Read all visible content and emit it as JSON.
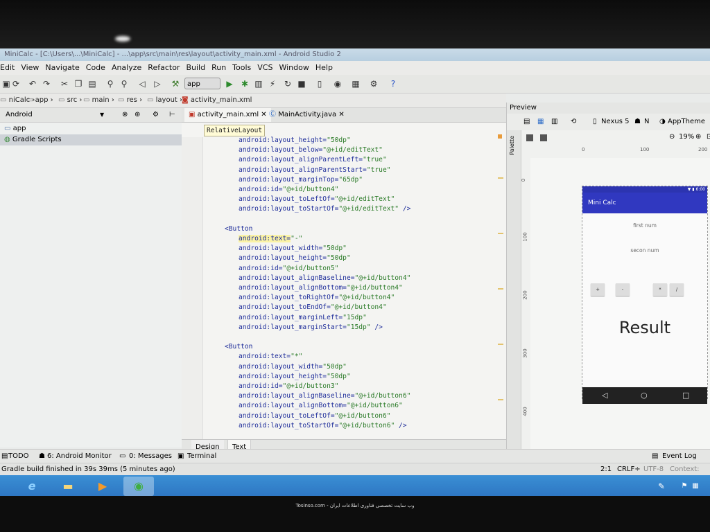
{
  "window": {
    "title": "MiniCalc - [C:\\Users\\...\\MiniCalc] - ...\\app\\src\\main\\res\\layout\\activity_main.xml - Android Studio 2"
  },
  "menu": [
    "Edit",
    "View",
    "Navigate",
    "Code",
    "Analyze",
    "Refactor",
    "Build",
    "Run",
    "Tools",
    "VCS",
    "Window",
    "Help"
  ],
  "toolbar": {
    "run_config": "app"
  },
  "breadcrumb": [
    "niCalc",
    "app",
    "src",
    "main",
    "res",
    "layout",
    "activity_main.xml"
  ],
  "project": {
    "view_mode": "Android",
    "items": [
      "app",
      "Gradle Scripts"
    ]
  },
  "editor": {
    "tabs": [
      "activity_main.xml",
      "MainActivity.java"
    ],
    "tooltip": "RelativeLayout",
    "lines": [
      {
        "indent": 2,
        "parts": [
          {
            "t": "android:layout_height=",
            "c": "an"
          },
          {
            "t": "\"50dp\"",
            "c": "av"
          }
        ]
      },
      {
        "indent": 2,
        "parts": [
          {
            "t": "android:layout_below=",
            "c": "an"
          },
          {
            "t": "\"@+id/editText\"",
            "c": "av"
          }
        ]
      },
      {
        "indent": 2,
        "parts": [
          {
            "t": "android:layout_alignParentLeft=",
            "c": "an"
          },
          {
            "t": "\"true\"",
            "c": "av"
          }
        ]
      },
      {
        "indent": 2,
        "parts": [
          {
            "t": "android:layout_alignParentStart=",
            "c": "an"
          },
          {
            "t": "\"true\"",
            "c": "av"
          }
        ]
      },
      {
        "indent": 2,
        "parts": [
          {
            "t": "android:layout_marginTop=",
            "c": "an"
          },
          {
            "t": "\"65dp\"",
            "c": "av"
          }
        ]
      },
      {
        "indent": 2,
        "parts": [
          {
            "t": "android:id=",
            "c": "an"
          },
          {
            "t": "\"@+id/button4\"",
            "c": "av"
          }
        ]
      },
      {
        "indent": 2,
        "parts": [
          {
            "t": "android:layout_toLeftOf=",
            "c": "an"
          },
          {
            "t": "\"@+id/editText\"",
            "c": "av"
          }
        ]
      },
      {
        "indent": 2,
        "parts": [
          {
            "t": "android:layout_toStartOf=",
            "c": "an"
          },
          {
            "t": "\"@+id/editText\"",
            "c": "av"
          },
          {
            "t": " />",
            "c": "tg"
          }
        ]
      },
      {
        "indent": 0,
        "parts": []
      },
      {
        "indent": 1,
        "parts": [
          {
            "t": "<Button",
            "c": "tg"
          }
        ]
      },
      {
        "indent": 2,
        "hl": true,
        "parts": [
          {
            "t": "android:text=",
            "c": "an"
          },
          {
            "t": "\"-\"",
            "c": "av"
          }
        ]
      },
      {
        "indent": 2,
        "parts": [
          {
            "t": "android:layout_width=",
            "c": "an"
          },
          {
            "t": "\"50dp\"",
            "c": "av"
          }
        ]
      },
      {
        "indent": 2,
        "parts": [
          {
            "t": "android:layout_height=",
            "c": "an"
          },
          {
            "t": "\"50dp\"",
            "c": "av"
          }
        ]
      },
      {
        "indent": 2,
        "parts": [
          {
            "t": "android:id=",
            "c": "an"
          },
          {
            "t": "\"@+id/button5\"",
            "c": "av"
          }
        ]
      },
      {
        "indent": 2,
        "parts": [
          {
            "t": "android:layout_alignBaseline=",
            "c": "an"
          },
          {
            "t": "\"@+id/button4\"",
            "c": "av"
          }
        ]
      },
      {
        "indent": 2,
        "parts": [
          {
            "t": "android:layout_alignBottom=",
            "c": "an"
          },
          {
            "t": "\"@+id/button4\"",
            "c": "av"
          }
        ]
      },
      {
        "indent": 2,
        "parts": [
          {
            "t": "android:layout_toRightOf=",
            "c": "an"
          },
          {
            "t": "\"@+id/button4\"",
            "c": "av"
          }
        ]
      },
      {
        "indent": 2,
        "parts": [
          {
            "t": "android:layout_toEndOf=",
            "c": "an"
          },
          {
            "t": "\"@+id/button4\"",
            "c": "av"
          }
        ]
      },
      {
        "indent": 2,
        "parts": [
          {
            "t": "android:layout_marginLeft=",
            "c": "an"
          },
          {
            "t": "\"15dp\"",
            "c": "av"
          }
        ]
      },
      {
        "indent": 2,
        "parts": [
          {
            "t": "android:layout_marginStart=",
            "c": "an"
          },
          {
            "t": "\"15dp\"",
            "c": "av"
          },
          {
            "t": " />",
            "c": "tg"
          }
        ]
      },
      {
        "indent": 0,
        "parts": []
      },
      {
        "indent": 1,
        "parts": [
          {
            "t": "<Button",
            "c": "tg"
          }
        ]
      },
      {
        "indent": 2,
        "parts": [
          {
            "t": "android:text=",
            "c": "an"
          },
          {
            "t": "\"*\"",
            "c": "av"
          }
        ]
      },
      {
        "indent": 2,
        "parts": [
          {
            "t": "android:layout_width=",
            "c": "an"
          },
          {
            "t": "\"50dp\"",
            "c": "av"
          }
        ]
      },
      {
        "indent": 2,
        "parts": [
          {
            "t": "android:layout_height=",
            "c": "an"
          },
          {
            "t": "\"50dp\"",
            "c": "av"
          }
        ]
      },
      {
        "indent": 2,
        "parts": [
          {
            "t": "android:id=",
            "c": "an"
          },
          {
            "t": "\"@+id/button3\"",
            "c": "av"
          }
        ]
      },
      {
        "indent": 2,
        "parts": [
          {
            "t": "android:layout_alignBaseline=",
            "c": "an"
          },
          {
            "t": "\"@+id/button6\"",
            "c": "av"
          }
        ]
      },
      {
        "indent": 2,
        "parts": [
          {
            "t": "android:layout_alignBottom=",
            "c": "an"
          },
          {
            "t": "\"@+id/button6\"",
            "c": "av"
          }
        ]
      },
      {
        "indent": 2,
        "parts": [
          {
            "t": "android:layout_toLeftOf=",
            "c": "an"
          },
          {
            "t": "\"@+id/button6\"",
            "c": "av"
          }
        ]
      },
      {
        "indent": 2,
        "parts": [
          {
            "t": "android:layout_toStartOf=",
            "c": "an"
          },
          {
            "t": "\"@+id/button6\"",
            "c": "av"
          },
          {
            "t": " />",
            "c": "tg"
          }
        ]
      }
    ],
    "bottom_tabs": [
      "Design",
      "Text"
    ]
  },
  "preview": {
    "title": "Preview",
    "palette_label": "Palette",
    "device": "Nexus 5",
    "api": "N",
    "theme": "AppTheme",
    "zoom": "19%",
    "ruler_top": [
      "0",
      "100",
      "200"
    ],
    "ruler_left": [
      "0",
      "100",
      "200",
      "300",
      "400"
    ],
    "phone": {
      "time": "6:00",
      "app_title": "Mini Calc",
      "hint1": "first num",
      "hint2": "secon num",
      "buttons": [
        "+",
        "-",
        "*",
        "/"
      ],
      "result": "Result"
    }
  },
  "toolwindows": [
    "TODO",
    "6: Android Monitor",
    "0: Messages",
    "Terminal"
  ],
  "event_log": "Event Log",
  "status": {
    "message": "Gradle build finished in 39s 39ms (5 minutes ago)",
    "position": "2:1",
    "line_sep": "CRLF÷",
    "encoding": "UTF-8",
    "context": "Context: <no"
  },
  "watermark": "Tosinso.com - وب سایت تخصصی فناوری اطلاعات ایران"
}
